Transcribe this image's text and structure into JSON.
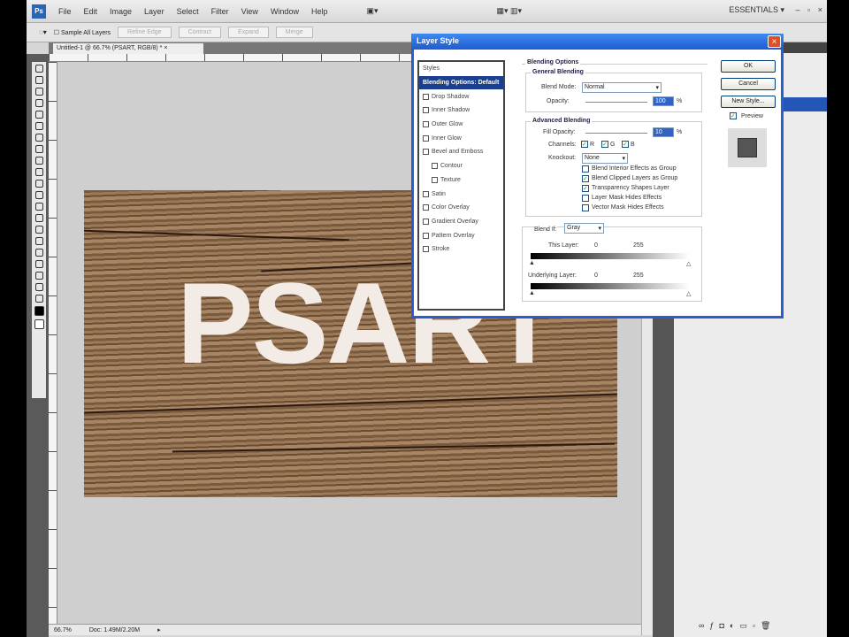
{
  "menu": {
    "items": [
      "File",
      "Edit",
      "Image",
      "Layer",
      "Select",
      "Filter",
      "View",
      "Window",
      "Help"
    ],
    "workspace": "ESSENTIALS ▾",
    "window_controls": [
      "–",
      "▫",
      "×"
    ]
  },
  "options": {
    "checkbox": "Sample All Layers",
    "buttons": [
      "Refine Edge",
      "Contract",
      "Expand",
      "Merge"
    ]
  },
  "document": {
    "tab": "Untitled-1 @ 66.7% (PSART, RGB/8) *",
    "zoom": "66.7%",
    "doc_size": "Doc: 1.49M/2.20M",
    "canvas_text": "PSART"
  },
  "dialog": {
    "title": "Layer Style",
    "styles": [
      {
        "label": "Styles",
        "type": "header"
      },
      {
        "label": "Blending Options: Default",
        "type": "selected"
      },
      {
        "label": "Drop Shadow",
        "checked": false
      },
      {
        "label": "Inner Shadow",
        "checked": false
      },
      {
        "label": "Outer Glow",
        "checked": false
      },
      {
        "label": "Inner Glow",
        "checked": false
      },
      {
        "label": "Bevel and Emboss",
        "checked": false
      },
      {
        "label": "Contour",
        "checked": false,
        "sub": true
      },
      {
        "label": "Texture",
        "checked": false,
        "sub": true
      },
      {
        "label": "Satin",
        "checked": false
      },
      {
        "label": "Color Overlay",
        "checked": false
      },
      {
        "label": "Gradient Overlay",
        "checked": false
      },
      {
        "label": "Pattern Overlay",
        "checked": false
      },
      {
        "label": "Stroke",
        "checked": false
      }
    ],
    "blending_options": "Blending Options",
    "general_blending": "General Blending",
    "blend_mode_label": "Blend Mode:",
    "blend_mode": "Normal",
    "opacity_label": "Opacity:",
    "opacity": "100",
    "pct": "%",
    "advanced_blending": "Advanced Blending",
    "fill_opacity_label": "Fill Opacity:",
    "fill_opacity": "10",
    "channels_label": "Channels:",
    "channels": [
      "R",
      "G",
      "B"
    ],
    "knockout_label": "Knockout:",
    "knockout": "None",
    "options": [
      {
        "label": "Blend Interior Effects as Group",
        "checked": false
      },
      {
        "label": "Blend Clipped Layers as Group",
        "checked": true
      },
      {
        "label": "Transparency Shapes Layer",
        "checked": true
      },
      {
        "label": "Layer Mask Hides Effects",
        "checked": false
      },
      {
        "label": "Vector Mask Hides Effects",
        "checked": false
      }
    ],
    "blend_if_label": "Blend If:",
    "blend_if": "Gray",
    "this_layer_label": "This Layer:",
    "this_layer": [
      "0",
      "255"
    ],
    "underlying_label": "Underlying Layer:",
    "underlying": [
      "0",
      "255"
    ],
    "buttons": {
      "ok": "OK",
      "cancel": "Cancel",
      "new_style": "New Style...",
      "preview": "Preview"
    }
  }
}
